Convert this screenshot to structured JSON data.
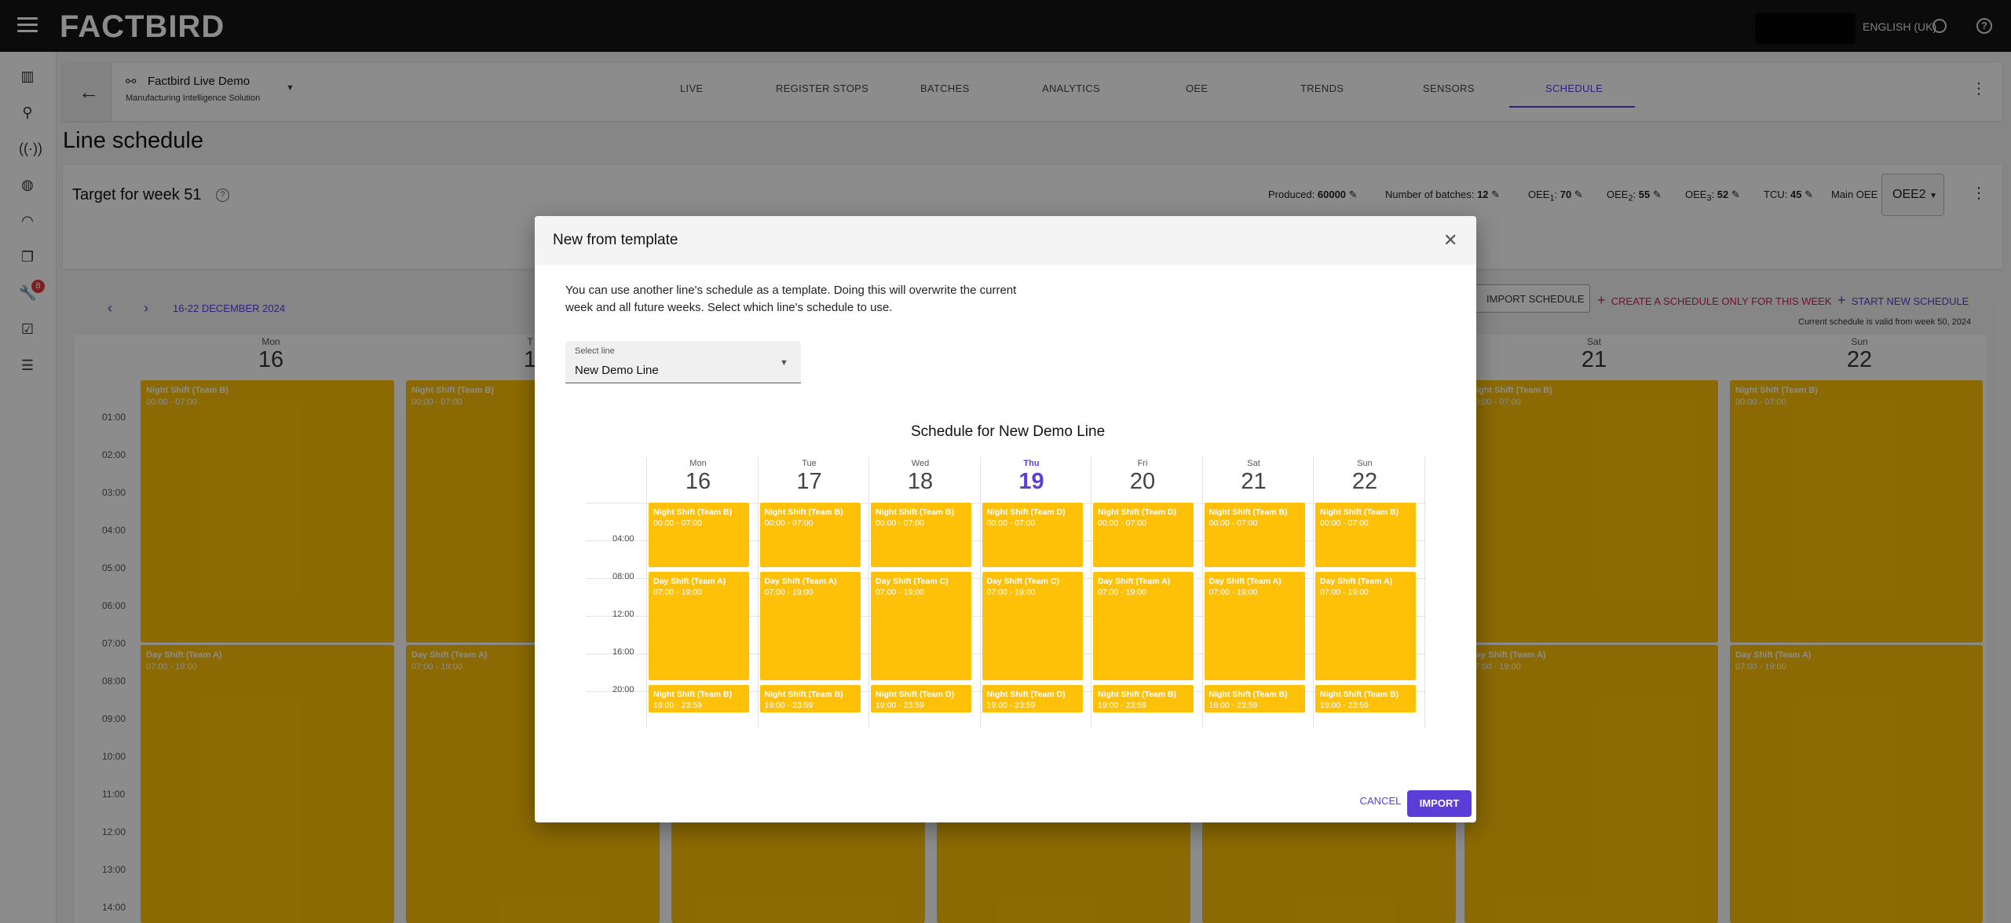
{
  "topbar": {
    "logo": "FACTBIRD",
    "language": "ENGLISH (UK)",
    "help": "?"
  },
  "rail": {
    "badge": "8"
  },
  "header": {
    "line_name": "Factbird Live Demo",
    "line_sub": "Manufacturing Intelligence Solution",
    "tabs": [
      "LIVE",
      "REGISTER STOPS",
      "BATCHES",
      "ANALYTICS",
      "OEE",
      "TRENDS",
      "SENSORS",
      "SCHEDULE"
    ],
    "active_tab": "SCHEDULE"
  },
  "page_title": "Line schedule",
  "target": {
    "title": "Target for week 51",
    "produced_label": "Produced:",
    "produced_value": "60000",
    "batches_label": "Number of batches:",
    "batches_value": "12",
    "oee1_label": "OEE",
    "oee1_sub": "1",
    "oee1_value": "70",
    "oee2_label": "OEE",
    "oee2_sub": "2",
    "oee2_value": "55",
    "oee3_label": "OEE",
    "oee3_sub": "3",
    "oee3_value": "52",
    "tcu_label": "TCU:",
    "tcu_value": "45",
    "main_oee_label": "Main OEE",
    "main_oee_value": "OEE2"
  },
  "toolbar": {
    "date_range": "16-22 DECEMBER 2024",
    "import_schedule": "IMPORT SCHEDULE",
    "create_week": "CREATE A SCHEDULE ONLY FOR THIS WEEK",
    "start_new": "START NEW SCHEDULE",
    "valid_note": "Current schedule is valid from week 50, 2024"
  },
  "background_calendar": {
    "days": [
      {
        "name": "Mon",
        "date": "16"
      },
      {
        "name": "T",
        "date": "1"
      },
      {
        "name": "Sat",
        "date": "21"
      },
      {
        "name": "Sun",
        "date": "22"
      }
    ],
    "hours": [
      "01:00",
      "02:00",
      "03:00",
      "04:00",
      "05:00",
      "06:00",
      "07:00",
      "08:00",
      "09:00",
      "10:00",
      "11:00",
      "12:00",
      "13:00",
      "14:00"
    ],
    "night_title": "Night Shift (Team B)",
    "night_time": "00:00 - 07:00",
    "day_title": "Day Shift (Team A)",
    "day_time": "07:00 - 19:00"
  },
  "dialog": {
    "title": "New from template",
    "text_line1": "You can use another line's schedule as a template. Doing this will overwrite the current",
    "text_line2": "week and all future weeks. Select which line's schedule to use.",
    "select_label": "Select line",
    "select_value": "New Demo Line",
    "schedule_title": "Schedule for New Demo Line",
    "hours": [
      "04:00",
      "08:00",
      "12:00",
      "16:00",
      "20:00"
    ],
    "days": [
      {
        "name": "Mon",
        "date": "16",
        "today": false,
        "shifts": [
          {
            "title": "Night Shift (Team B)",
            "time": "00:00 - 07:00"
          },
          {
            "title": "Day Shift (Team A)",
            "time": "07:00 - 19:00"
          },
          {
            "title": "Night Shift (Team B)",
            "time": "19:00 - 23:59"
          }
        ]
      },
      {
        "name": "Tue",
        "date": "17",
        "today": false,
        "shifts": [
          {
            "title": "Night Shift (Team B)",
            "time": "00:00 - 07:00"
          },
          {
            "title": "Day Shift (Team A)",
            "time": "07:00 - 19:00"
          },
          {
            "title": "Night Shift (Team B)",
            "time": "19:00 - 23:59"
          }
        ]
      },
      {
        "name": "Wed",
        "date": "18",
        "today": false,
        "shifts": [
          {
            "title": "Night Shift (Team B)",
            "time": "00:00 - 07:00"
          },
          {
            "title": "Day Shift (Team C)",
            "time": "07:00 - 19:00"
          },
          {
            "title": "Night Shift (Team D)",
            "time": "19:00 - 23:59"
          }
        ]
      },
      {
        "name": "Thu",
        "date": "19",
        "today": true,
        "shifts": [
          {
            "title": "Night Shift (Team D)",
            "time": "00:00 - 07:00"
          },
          {
            "title": "Day Shift (Team C)",
            "time": "07:00 - 19:00"
          },
          {
            "title": "Night Shift (Team D)",
            "time": "19:00 - 23:59"
          }
        ]
      },
      {
        "name": "Fri",
        "date": "20",
        "today": false,
        "shifts": [
          {
            "title": "Night Shift (Team D)",
            "time": "00:00 - 07:00"
          },
          {
            "title": "Day Shift (Team A)",
            "time": "07:00 - 19:00"
          },
          {
            "title": "Night Shift (Team B)",
            "time": "19:00 - 23:59"
          }
        ]
      },
      {
        "name": "Sat",
        "date": "21",
        "today": false,
        "shifts": [
          {
            "title": "Night Shift (Team B)",
            "time": "00:00 - 07:00"
          },
          {
            "title": "Day Shift (Team A)",
            "time": "07:00 - 19:00"
          },
          {
            "title": "Night Shift (Team B)",
            "time": "19:00 - 23:59"
          }
        ]
      },
      {
        "name": "Sun",
        "date": "22",
        "today": false,
        "shifts": [
          {
            "title": "Night Shift (Team B)",
            "time": "00:00 - 07:00"
          },
          {
            "title": "Day Shift (Team A)",
            "time": "07:00 - 19:00"
          },
          {
            "title": "Night Shift (Team B)",
            "time": "19:00 - 23:59"
          }
        ]
      }
    ],
    "cancel": "CANCEL",
    "import": "IMPORT"
  }
}
